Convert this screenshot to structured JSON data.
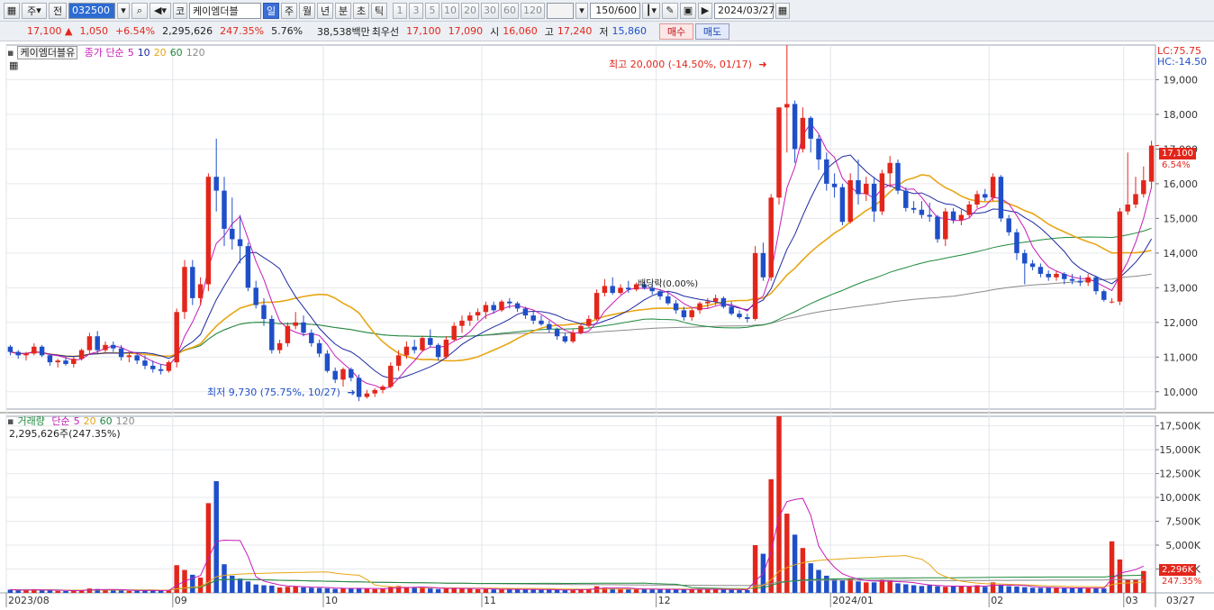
{
  "toolbar": {
    "period_btn": "주",
    "all_btn": "전",
    "stock_code": "032500",
    "market_btn": "코",
    "stock_name": "케이엠더블",
    "timeframes": [
      "일",
      "주",
      "월",
      "년",
      "분",
      "초",
      "틱"
    ],
    "selected_timeframe": "일",
    "minute_units": [
      "1",
      "3",
      "5",
      "10",
      "20",
      "30",
      "60",
      "120"
    ],
    "count": "150/600",
    "date": "2024/03/27"
  },
  "quote": {
    "price": "17,100",
    "change": "1,050",
    "change_pct": "+6.54%",
    "volume": "2,295,626",
    "volume_ratio": "247.35%",
    "turnover": "5.76%",
    "amount": "38,538백만",
    "priority_label": "최우선",
    "ask": "17,100",
    "bid": "17,090",
    "open_label": "시",
    "open": "16,060",
    "high_label": "고",
    "high": "17,240",
    "low_label": "저",
    "low": "15,860",
    "buy_btn": "매수",
    "sell_btn": "매도"
  },
  "price_panel": {
    "legend_name": "케이엠더블유",
    "legend_ma_label": "종가 단순",
    "ma_periods": [
      "5",
      "10",
      "20",
      "60",
      "120"
    ],
    "lc": "LC:75.75",
    "hc": "HC:-14.50",
    "y_ticks": [
      "19,000",
      "18,000",
      "17,000",
      "16,000",
      "15,000",
      "14,000",
      "13,000",
      "12,000",
      "11,000",
      "10,000"
    ],
    "last_price_tag": "17,100",
    "last_pct_tag": "6.54%",
    "high_annotation": "최고 20,000 (-14.50%, 01/17)",
    "low_annotation": "최저 9,730 (75.75%, 10/27)",
    "event_annotation": "배당락(0.00%)"
  },
  "volume_panel": {
    "legend_label": "거래량",
    "legend_ma_label": "단순",
    "ma_periods": [
      "5",
      "20",
      "60",
      "120"
    ],
    "value_line": "2,295,626주(247.35%)",
    "y_ticks": [
      "17,500K",
      "15,000K",
      "12,500K",
      "10,000K",
      "7,500K",
      "5,000K",
      "2,500K"
    ],
    "last_volume_tag": "2,296K",
    "last_pct_tag": "247.35%"
  },
  "x_axis": {
    "labels": [
      "2023/08",
      "09",
      "10",
      "11",
      "12",
      "2024/01",
      "02",
      "03"
    ],
    "last_label": "03/27"
  },
  "colors": {
    "up": "#e3261b",
    "down": "#1f4fc8",
    "ma5": "#c71ab8",
    "ma10": "#1f2aa0",
    "ma20": "#e8a514",
    "ma60": "#1e8a3c",
    "ma120": "#8a8a8a"
  },
  "chart_data": {
    "type": "candlestick",
    "y_range": [
      9500,
      20000
    ],
    "volume_range_k": [
      0,
      18500
    ],
    "month_start_index": [
      0,
      21,
      40,
      60,
      82,
      104,
      124,
      141
    ],
    "candles": [
      [
        11300,
        11350,
        11050,
        11150
      ],
      [
        11150,
        11200,
        10950,
        11050
      ],
      [
        11050,
        11150,
        10900,
        11100
      ],
      [
        11100,
        11400,
        11050,
        11300
      ],
      [
        11300,
        11350,
        11000,
        11050
      ],
      [
        11050,
        11100,
        10750,
        10850
      ],
      [
        10850,
        10950,
        10700,
        10900
      ],
      [
        10900,
        11000,
        10750,
        10800
      ],
      [
        10800,
        11000,
        10700,
        10950
      ],
      [
        10950,
        11250,
        10900,
        11200
      ],
      [
        11200,
        11700,
        11100,
        11600
      ],
      [
        11600,
        11750,
        11100,
        11200
      ],
      [
        11200,
        11450,
        11100,
        11350
      ],
      [
        11350,
        11450,
        11150,
        11250
      ],
      [
        11250,
        11350,
        10900,
        11000
      ],
      [
        11000,
        11150,
        10850,
        11050
      ],
      [
        11050,
        11100,
        10800,
        10900
      ],
      [
        10900,
        11050,
        10650,
        10750
      ],
      [
        10750,
        10900,
        10550,
        10650
      ],
      [
        10650,
        10800,
        10500,
        10600
      ],
      [
        10600,
        10900,
        10550,
        10850
      ],
      [
        10850,
        12400,
        10700,
        12300
      ],
      [
        12300,
        13800,
        12100,
        13600
      ],
      [
        13600,
        13800,
        12500,
        12700
      ],
      [
        12700,
        13300,
        12500,
        13100
      ],
      [
        13100,
        16300,
        12900,
        16200
      ],
      [
        16200,
        17300,
        15200,
        15800
      ],
      [
        15800,
        16200,
        14200,
        14700
      ],
      [
        14700,
        15600,
        14100,
        14400
      ],
      [
        14400,
        15100,
        13700,
        14200
      ],
      [
        14200,
        14300,
        12900,
        13000
      ],
      [
        13000,
        13200,
        12400,
        12500
      ],
      [
        12500,
        12700,
        11900,
        12100
      ],
      [
        12100,
        12200,
        11100,
        11200
      ],
      [
        11200,
        11500,
        11100,
        11400
      ],
      [
        11400,
        12000,
        11300,
        11900
      ],
      [
        11900,
        12300,
        11800,
        12000
      ],
      [
        12000,
        12200,
        11600,
        11700
      ],
      [
        11700,
        11800,
        11300,
        11400
      ],
      [
        11400,
        11500,
        11000,
        11100
      ],
      [
        11100,
        11200,
        10550,
        10600
      ],
      [
        10600,
        10700,
        10250,
        10350
      ],
      [
        10350,
        10700,
        10150,
        10650
      ],
      [
        10650,
        10700,
        10300,
        10400
      ],
      [
        10400,
        10500,
        9730,
        9850
      ],
      [
        9850,
        10050,
        9800,
        9950
      ],
      [
        9950,
        10100,
        9850,
        10050
      ],
      [
        10050,
        10200,
        9950,
        10150
      ],
      [
        10150,
        10850,
        10100,
        10750
      ],
      [
        10750,
        11200,
        10600,
        11050
      ],
      [
        11050,
        11450,
        10950,
        11300
      ],
      [
        11300,
        11500,
        11100,
        11200
      ],
      [
        11200,
        11600,
        11150,
        11550
      ],
      [
        11550,
        11800,
        11300,
        11350
      ],
      [
        11350,
        11400,
        10900,
        11000
      ],
      [
        11000,
        11600,
        10950,
        11500
      ],
      [
        11500,
        12000,
        11450,
        11900
      ],
      [
        11900,
        12200,
        11700,
        12050
      ],
      [
        12050,
        12300,
        11900,
        12200
      ],
      [
        12200,
        12400,
        12050,
        12300
      ],
      [
        12300,
        12600,
        12100,
        12500
      ],
      [
        12500,
        12600,
        12250,
        12350
      ],
      [
        12350,
        12650,
        12300,
        12600
      ],
      [
        12600,
        12700,
        12400,
        12550
      ],
      [
        12550,
        12600,
        12300,
        12400
      ],
      [
        12400,
        12450,
        12100,
        12200
      ],
      [
        12200,
        12300,
        11950,
        12050
      ],
      [
        12050,
        12200,
        11900,
        11950
      ],
      [
        11950,
        12050,
        11700,
        11800
      ],
      [
        11800,
        11850,
        11500,
        11600
      ],
      [
        11600,
        11700,
        11400,
        11450
      ],
      [
        11450,
        11800,
        11400,
        11700
      ],
      [
        11700,
        11950,
        11650,
        11900
      ],
      [
        11900,
        12200,
        11850,
        12100
      ],
      [
        12100,
        12950,
        12050,
        12850
      ],
      [
        12850,
        13250,
        12750,
        13050
      ],
      [
        13050,
        13300,
        12800,
        12850
      ],
      [
        12850,
        13100,
        12800,
        13000
      ],
      [
        13000,
        13200,
        12850,
        12950
      ],
      [
        12950,
        13150,
        12900,
        13100
      ],
      [
        13100,
        13200,
        12950,
        13000
      ],
      [
        13000,
        13150,
        12800,
        12900
      ],
      [
        12900,
        12950,
        12650,
        12750
      ],
      [
        12750,
        12850,
        12500,
        12550
      ],
      [
        12550,
        12650,
        12250,
        12350
      ],
      [
        12350,
        12450,
        12050,
        12150
      ],
      [
        12150,
        12400,
        12050,
        12350
      ],
      [
        12350,
        12600,
        12250,
        12550
      ],
      [
        12550,
        12700,
        12400,
        12600
      ],
      [
        12600,
        12800,
        12500,
        12700
      ],
      [
        12700,
        12750,
        12400,
        12450
      ],
      [
        12450,
        12600,
        12200,
        12250
      ],
      [
        12250,
        12350,
        12100,
        12150
      ],
      [
        12150,
        12250,
        12000,
        12100
      ],
      [
        12100,
        14200,
        12050,
        14000
      ],
      [
        14000,
        14300,
        13200,
        13300
      ],
      [
        13300,
        15700,
        13200,
        15600
      ],
      [
        15600,
        18200,
        15400,
        18200
      ],
      [
        18200,
        20000,
        16900,
        18300
      ],
      [
        18300,
        18400,
        16600,
        17000
      ],
      [
        17000,
        18200,
        16900,
        17900
      ],
      [
        17900,
        17950,
        16900,
        17300
      ],
      [
        17300,
        17400,
        16400,
        16700
      ],
      [
        16700,
        16900,
        15800,
        16000
      ],
      [
        16000,
        16300,
        15600,
        15900
      ],
      [
        15900,
        16000,
        14800,
        14900
      ],
      [
        14900,
        16300,
        14850,
        16100
      ],
      [
        16100,
        16700,
        15400,
        15700
      ],
      [
        15700,
        16200,
        15500,
        16000
      ],
      [
        16000,
        16200,
        14900,
        15200
      ],
      [
        15200,
        16400,
        15100,
        16300
      ],
      [
        16300,
        16800,
        15900,
        16600
      ],
      [
        16600,
        16700,
        15700,
        15800
      ],
      [
        15800,
        15900,
        15200,
        15300
      ],
      [
        15300,
        15500,
        15150,
        15250
      ],
      [
        15250,
        15500,
        15000,
        15100
      ],
      [
        15100,
        15450,
        14900,
        15050
      ],
      [
        15050,
        15100,
        14300,
        14400
      ],
      [
        14400,
        15300,
        14200,
        15200
      ],
      [
        15200,
        15300,
        14850,
        14950
      ],
      [
        14950,
        15250,
        14800,
        15100
      ],
      [
        15100,
        15500,
        15000,
        15400
      ],
      [
        15400,
        15800,
        15300,
        15700
      ],
      [
        15700,
        15850,
        15500,
        15600
      ],
      [
        15600,
        16300,
        15500,
        16200
      ],
      [
        16200,
        16250,
        14900,
        15000
      ],
      [
        15000,
        15100,
        14500,
        14600
      ],
      [
        14600,
        14700,
        13800,
        14000
      ],
      [
        14000,
        14100,
        13100,
        13700
      ],
      [
        13700,
        13800,
        13500,
        13600
      ],
      [
        13600,
        13700,
        13300,
        13400
      ],
      [
        13400,
        13500,
        13200,
        13300
      ],
      [
        13300,
        13500,
        13200,
        13400
      ],
      [
        13400,
        13450,
        13100,
        13250
      ],
      [
        13250,
        13400,
        13100,
        13200
      ],
      [
        13200,
        13350,
        13050,
        13150
      ],
      [
        13150,
        13400,
        13050,
        13300
      ],
      [
        13300,
        13350,
        12800,
        12900
      ],
      [
        12900,
        12950,
        12600,
        12650
      ],
      [
        12600,
        12700,
        12550,
        12600
      ],
      [
        12600,
        15300,
        12500,
        15200
      ],
      [
        15200,
        16900,
        15100,
        15400
      ],
      [
        15400,
        16200,
        15300,
        15700
      ],
      [
        15700,
        16500,
        15600,
        16100
      ],
      [
        16060,
        17240,
        15860,
        17100
      ]
    ],
    "volume_k": [
      340,
      290,
      260,
      390,
      300,
      240,
      210,
      200,
      250,
      330,
      460,
      410,
      300,
      270,
      240,
      210,
      230,
      260,
      300,
      240,
      240,
      2900,
      2400,
      1900,
      1600,
      9400,
      11700,
      3000,
      1800,
      1500,
      1200,
      880,
      800,
      760,
      560,
      640,
      700,
      580,
      540,
      510,
      480,
      420,
      470,
      480,
      520,
      440,
      390,
      420,
      650,
      720,
      620,
      540,
      520,
      460,
      400,
      430,
      560,
      500,
      420,
      380,
      400,
      360,
      350,
      380,
      400,
      360,
      340,
      320,
      330,
      300,
      280,
      350,
      420,
      430,
      690,
      560,
      460,
      430,
      400,
      430,
      380,
      360,
      340,
      360,
      380,
      370,
      360,
      400,
      380,
      360,
      330,
      320,
      300,
      290,
      5000,
      4100,
      11900,
      18500,
      8300,
      6100,
      4700,
      3100,
      2400,
      1800,
      1400,
      1300,
      1500,
      1200,
      1100,
      1100,
      1400,
      1300,
      1000,
      900,
      800,
      720,
      800,
      700,
      640,
      680,
      720,
      700,
      800,
      640,
      1100,
      840,
      700,
      660,
      600,
      540,
      520,
      560,
      520,
      500,
      480,
      540,
      500,
      480,
      460,
      5400,
      3500,
      1400,
      1400,
      2296
    ]
  }
}
